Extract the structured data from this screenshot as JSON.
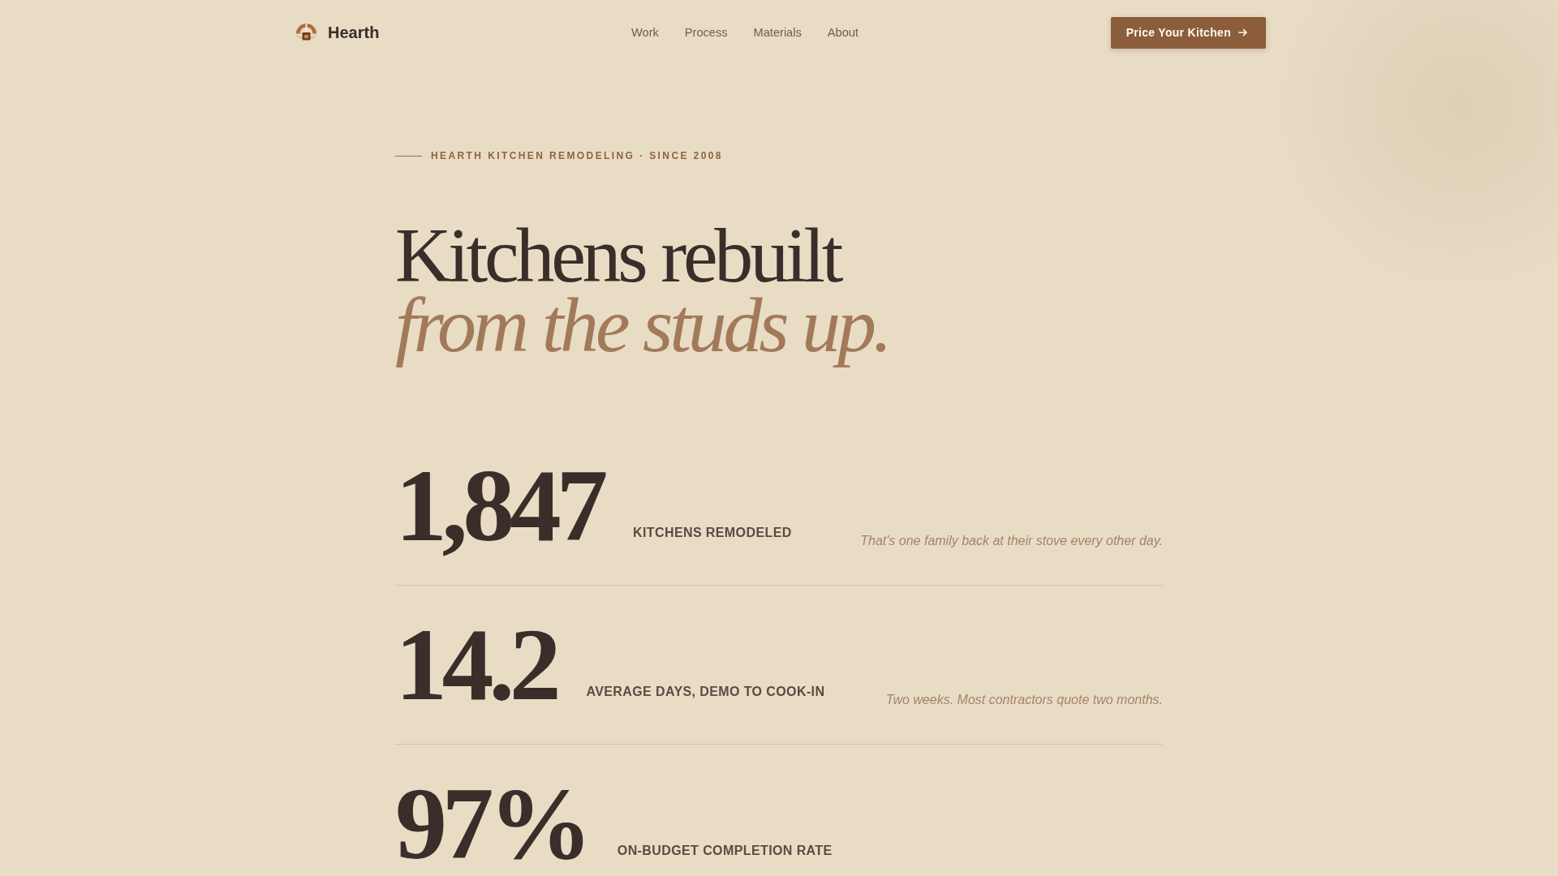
{
  "header": {
    "brand": "Hearth",
    "nav": [
      {
        "label": "Work"
      },
      {
        "label": "Process"
      },
      {
        "label": "Materials"
      },
      {
        "label": "About"
      }
    ],
    "cta": {
      "label": "Price Your Kitchen"
    }
  },
  "hero": {
    "eyebrow": "HEARTH KITCHEN REMODELING · SINCE 2008",
    "headline": "Kitchens rebuilt",
    "headline_accent": "from the studs up."
  },
  "stats": [
    {
      "value": "1,847",
      "label": "KITCHENS REMODELED",
      "note": "That's one family back at their stove every other day."
    },
    {
      "value": "14.2",
      "label": "AVERAGE DAYS, DEMO TO COOK-IN",
      "note": "Two weeks. Most contractors quote two months."
    },
    {
      "value": "97%",
      "label": "ON-BUDGET COMPLETION RATE"
    }
  ]
}
